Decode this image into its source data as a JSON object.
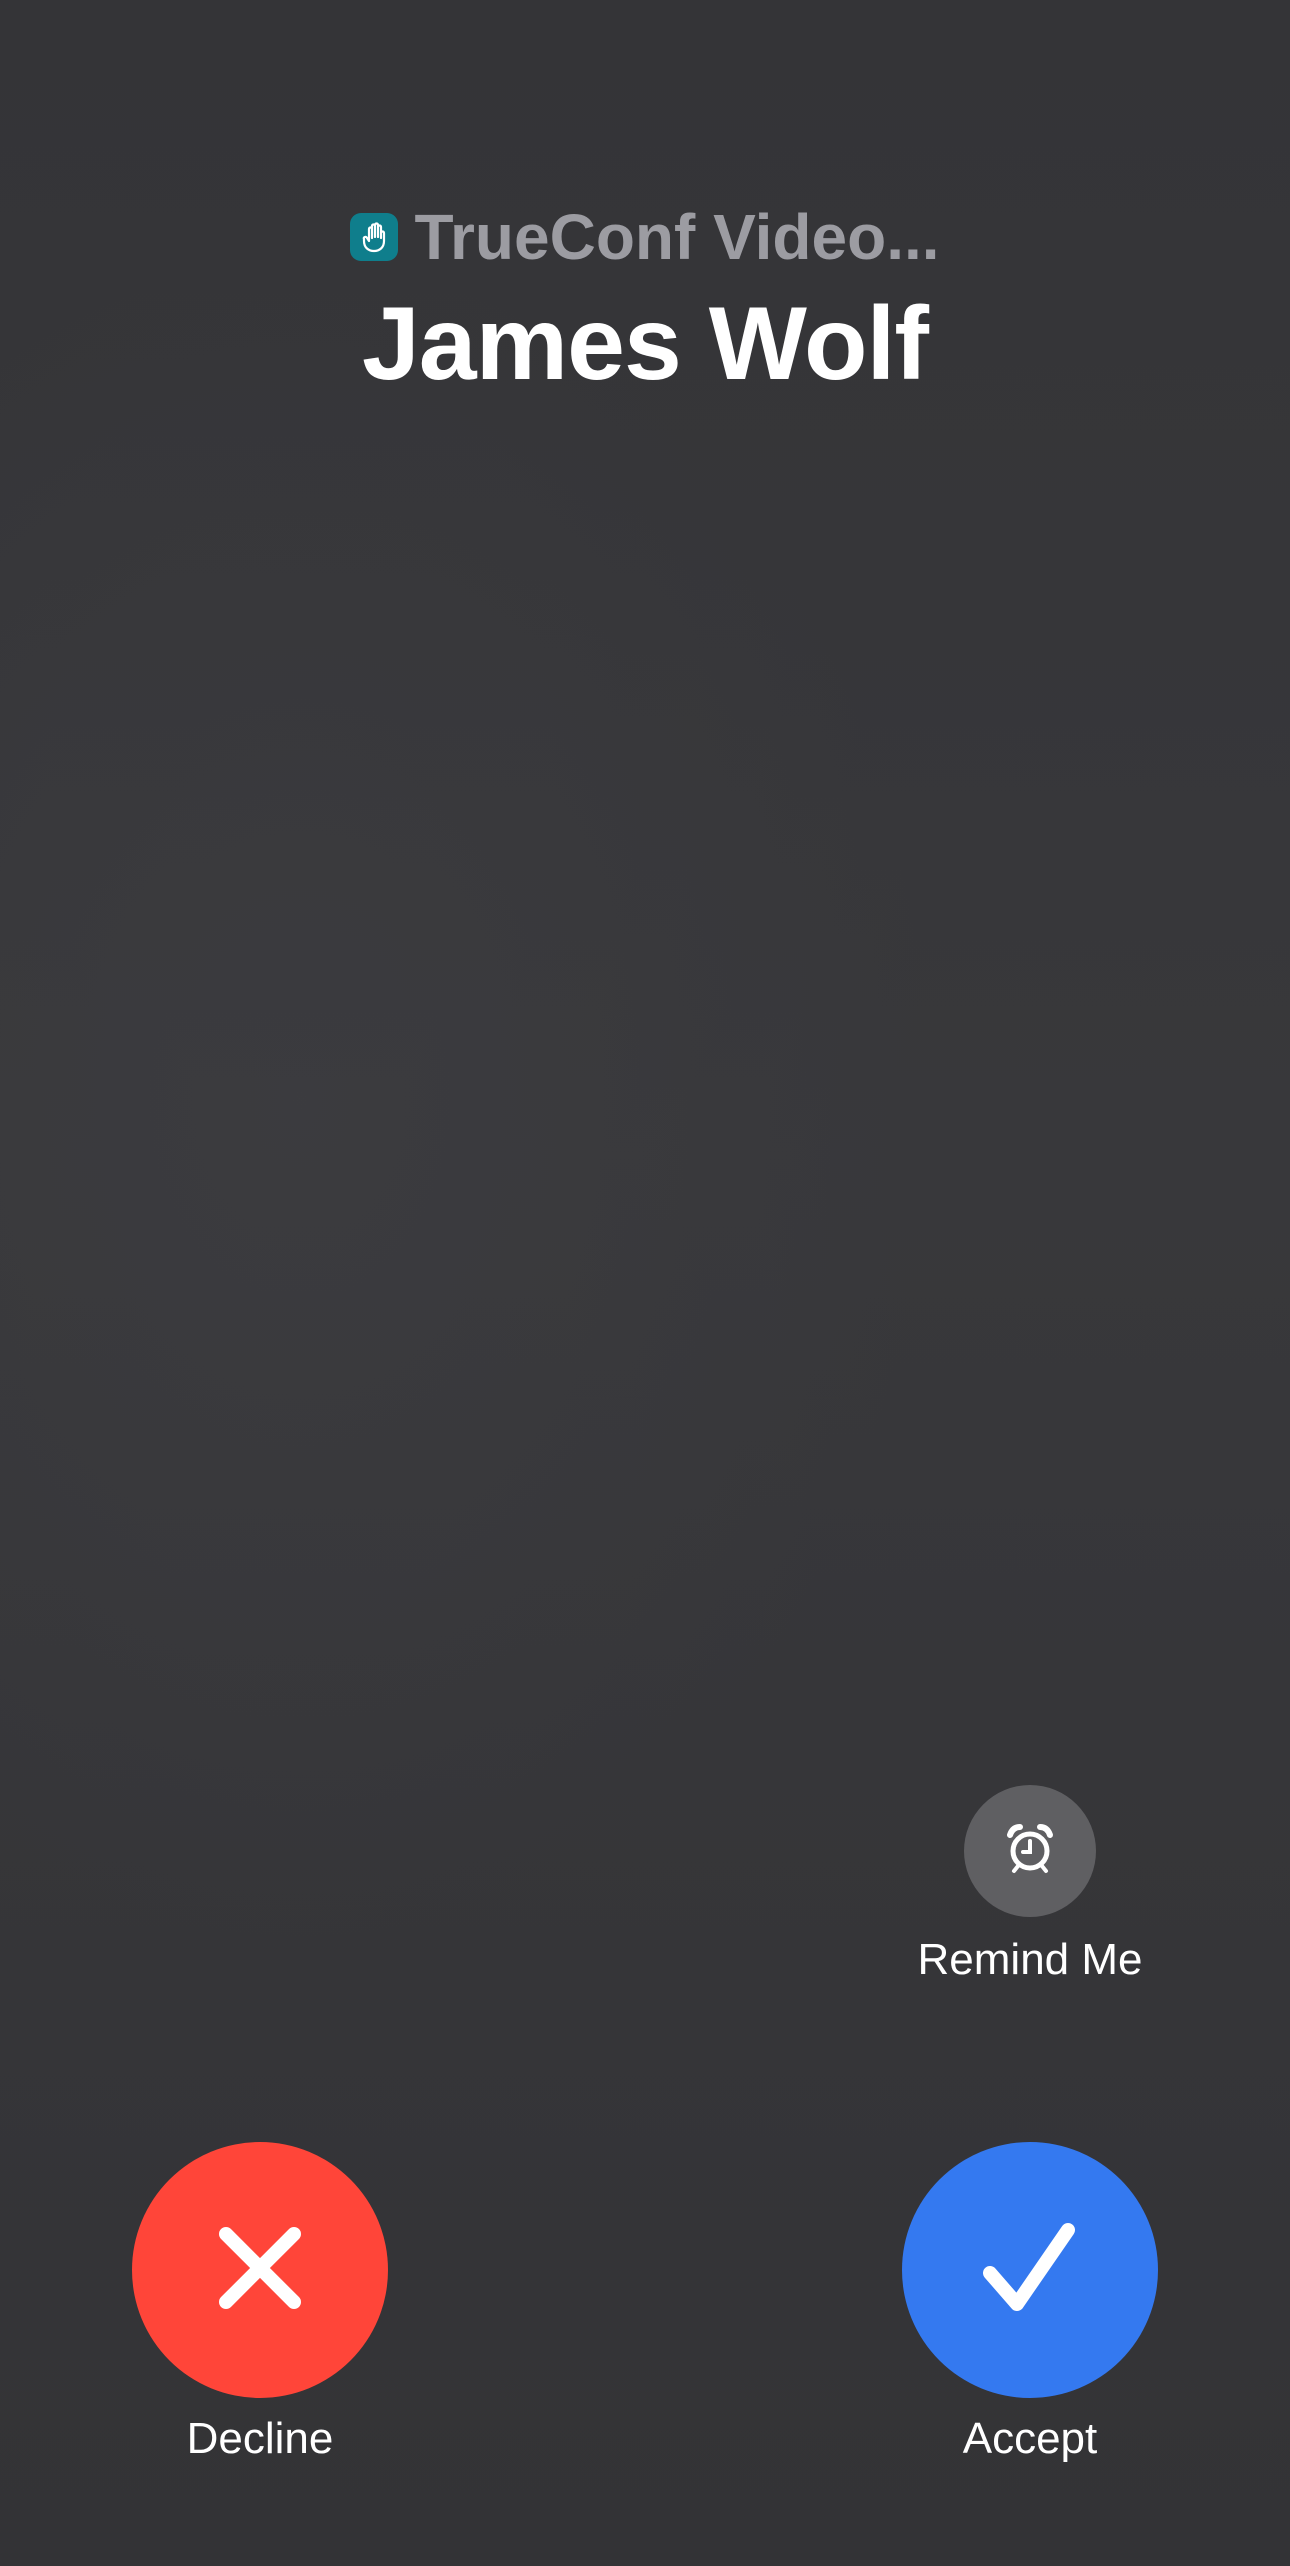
{
  "header": {
    "app_name": "TrueConf Video...",
    "app_icon": "trueconf-app-icon",
    "caller_name": "James Wolf"
  },
  "remind": {
    "label": "Remind Me",
    "icon": "alarm-clock-icon"
  },
  "actions": {
    "decline": {
      "label": "Decline",
      "icon": "close-icon",
      "color": "#ff4539"
    },
    "accept": {
      "label": "Accept",
      "icon": "checkmark-icon",
      "color": "#3479f0"
    }
  }
}
